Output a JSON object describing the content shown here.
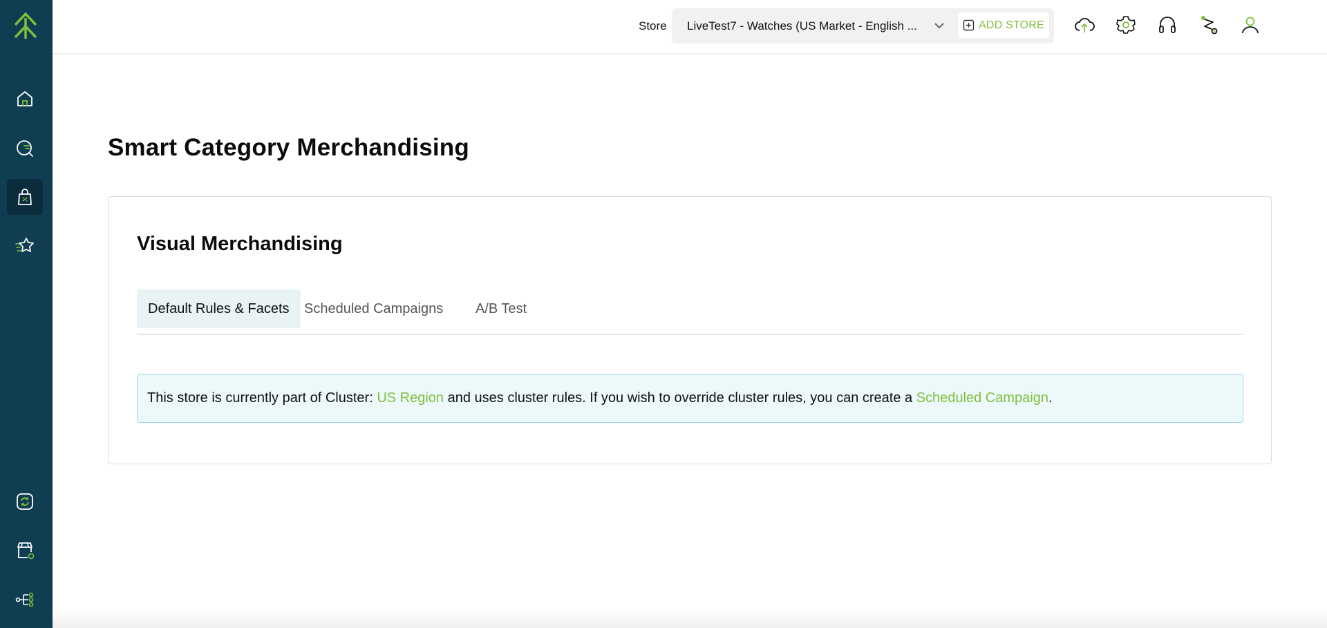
{
  "header": {
    "store_label": "Store",
    "store_value": "LiveTest7 - Watches (US Market - English ...",
    "add_store_label": "ADD STORE"
  },
  "page": {
    "title": "Smart Category Merchandising"
  },
  "card": {
    "title": "Visual Merchandising",
    "tabs": [
      {
        "label": "Default Rules & Facets"
      },
      {
        "label": "Scheduled Campaigns"
      },
      {
        "label": "A/B Test"
      }
    ],
    "notice": {
      "part1": "This store is currently part of Cluster: ",
      "cluster_link": "US Region",
      "part2": " and uses cluster rules. If you wish to override cluster rules, you can create a ",
      "campaign_link": "Scheduled Campaign",
      "part3": "."
    }
  },
  "colors": {
    "sidebar_bg": "#0f3d52",
    "accent_green": "#7fbf3b",
    "notice_bg": "#edf8fb"
  },
  "icons": {
    "sidebar": [
      "logo-chevrons-icon",
      "home-icon",
      "search-analytics-icon",
      "shopping-bag-icon",
      "star-list-icon",
      "sync-icon",
      "storefront-icon",
      "workflow-icon"
    ],
    "topbar": [
      "cloud-upload-icon",
      "settings-gear-icon",
      "headset-icon",
      "route-icon",
      "user-icon"
    ]
  }
}
